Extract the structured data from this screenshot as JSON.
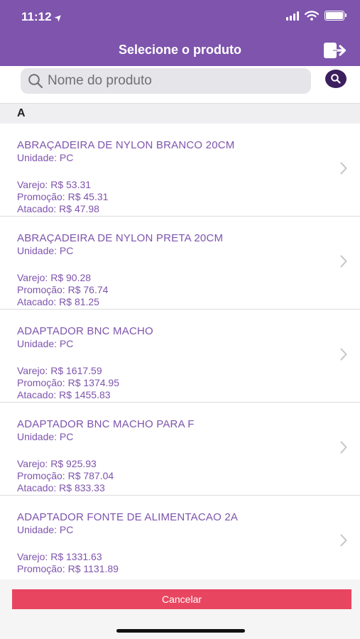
{
  "status_bar": {
    "time": "11:12"
  },
  "header": {
    "title": "Selecione o produto"
  },
  "search": {
    "placeholder": "Nome do produto"
  },
  "section": {
    "letter": "A"
  },
  "products": [
    {
      "name": "ABRAÇADEIRA DE NYLON BRANCO 20CM",
      "unit": "Unidade: PC",
      "varejo": "Varejo: R$ 53.31",
      "promocao": "Promoção: R$ 45.31",
      "atacado": "Atacado: R$ 47.98"
    },
    {
      "name": "ABRAÇADEIRA DE NYLON PRETA 20CM",
      "unit": "Unidade: PC",
      "varejo": "Varejo: R$ 90.28",
      "promocao": "Promoção: R$ 76.74",
      "atacado": "Atacado: R$ 81.25"
    },
    {
      "name": "ADAPTADOR BNC MACHO",
      "unit": "Unidade: PC",
      "varejo": "Varejo: R$ 1617.59",
      "promocao": "Promoção: R$ 1374.95",
      "atacado": "Atacado: R$ 1455.83"
    },
    {
      "name": "ADAPTADOR BNC MACHO PARA F",
      "unit": "Unidade: PC",
      "varejo": "Varejo: R$ 925.93",
      "promocao": "Promoção: R$ 787.04",
      "atacado": "Atacado: R$ 833.33"
    },
    {
      "name": "ADAPTADOR FONTE DE ALIMENTACAO 2A",
      "unit": "Unidade: PC",
      "varejo": "Varejo: R$ 1331.63",
      "promocao": "Promoção: R$ 1131.89",
      "atacado": ""
    }
  ],
  "footer": {
    "cancel_label": "Cancelar"
  },
  "colors": {
    "header": "#7e54ad",
    "cancel": "#e84660",
    "text_purple": "#7e54ad",
    "search_button": "#3b1f5e"
  },
  "icons": {
    "location": "location-arrow-icon",
    "signal": "signal-icon",
    "wifi": "wifi-icon",
    "battery": "battery-icon",
    "logout": "logout-icon",
    "search": "search-icon",
    "chevron": "chevron-right-icon"
  }
}
